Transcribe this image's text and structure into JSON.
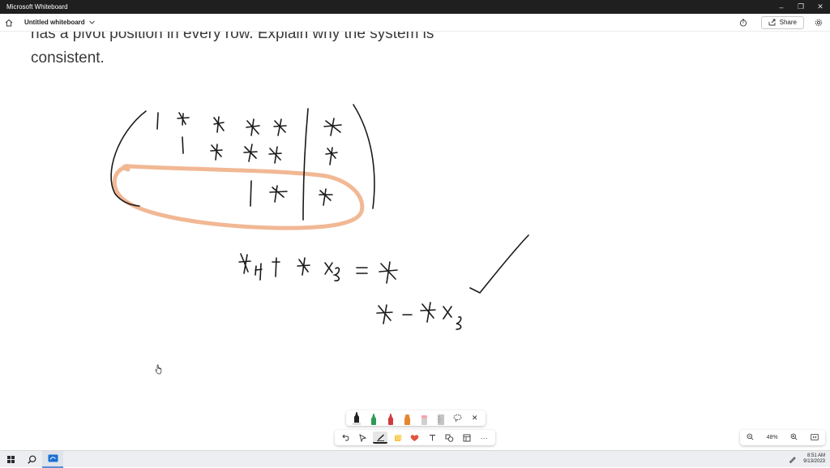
{
  "window": {
    "app_title": "Microsoft Whiteboard",
    "minimize_icon": "minimize-icon",
    "maximize_icon": "restore-icon",
    "close_icon": "close-icon"
  },
  "appbar": {
    "board_title": "Untitled whiteboard",
    "share_label": "Share",
    "icons": [
      "home-icon",
      "chevron-down-icon",
      "timer-icon",
      "share-icon",
      "settings-icon"
    ]
  },
  "canvas": {
    "question_line1": "has a pivot position in every row. Explain why the system is",
    "question_line2": "consistent.",
    "ink_colors": {
      "black": "#1a1a1a",
      "highlighter": "#f1b894"
    }
  },
  "pen_tray": {
    "pens": [
      {
        "name": "black-pen",
        "color": "#222222"
      },
      {
        "name": "green-pen",
        "color": "#2e9a57"
      },
      {
        "name": "red-pen",
        "color": "#d23a3a"
      },
      {
        "name": "orange-pen",
        "color": "#e6862d"
      },
      {
        "name": "eraser",
        "color": "#f2a7b4"
      },
      {
        "name": "ruler",
        "color": "#b8b8b8"
      }
    ],
    "close_label": "✕"
  },
  "toolbar": {
    "tools": [
      "undo-icon",
      "select-icon",
      "ink-icon",
      "sticky-note-icon",
      "reaction-icon",
      "text-icon",
      "shapes-icon",
      "templates-icon",
      "more-icon"
    ],
    "more_label": "···"
  },
  "zoom": {
    "level": "48%"
  },
  "taskbar": {
    "time": "8:51 AM",
    "date": "9/13/2023"
  }
}
